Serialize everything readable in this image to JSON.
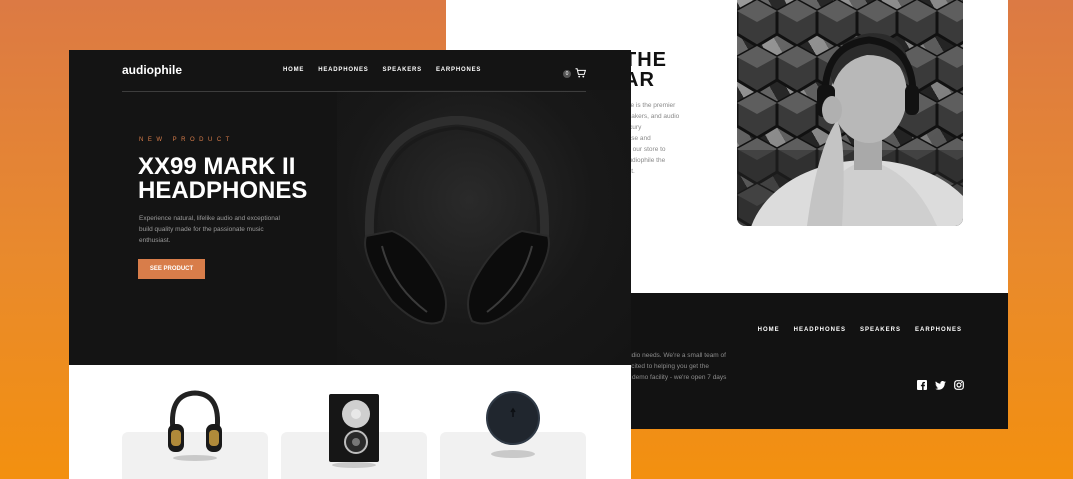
{
  "back_page": {
    "heading_lines": [
      "THE",
      "AR"
    ],
    "paragraph_lines": [
      "hile is the premier",
      "peakers, and audio",
      "luxury",
      "oase and",
      "by our store to",
      "Audiophile the",
      "ont."
    ],
    "footer": {
      "nav": [
        "HOME",
        "HEADPHONES",
        "SPEAKERS",
        "EARPHONES"
      ],
      "paragraph_lines": [
        "udio needs. We're a small team of",
        "xcited to helping you get the",
        "r demo facility - we're open 7 days"
      ],
      "social_icons": [
        "facebook-icon",
        "twitter-icon",
        "instagram-icon"
      ]
    }
  },
  "front_page": {
    "logo": "audiophile",
    "nav": [
      "HOME",
      "HEADPHONES",
      "SPEAKERS",
      "EARPHONES"
    ],
    "cart_count": "0",
    "hero": {
      "overline": "NEW PRODUCT",
      "title_lines": [
        "XX99 MARK II",
        "HEADPHONES"
      ],
      "description_lines": [
        "Experience natural, lifelike audio and exceptional",
        "build quality made for the passionate music",
        "enthusiast."
      ],
      "cta_label": "SEE PRODUCT"
    },
    "category_cards": [
      "headphones",
      "speakers",
      "earphones"
    ]
  },
  "colors": {
    "accent": "#d87d4a",
    "dark": "#141414",
    "background_top": "#dc7a44",
    "background_bottom": "#f3900f"
  }
}
